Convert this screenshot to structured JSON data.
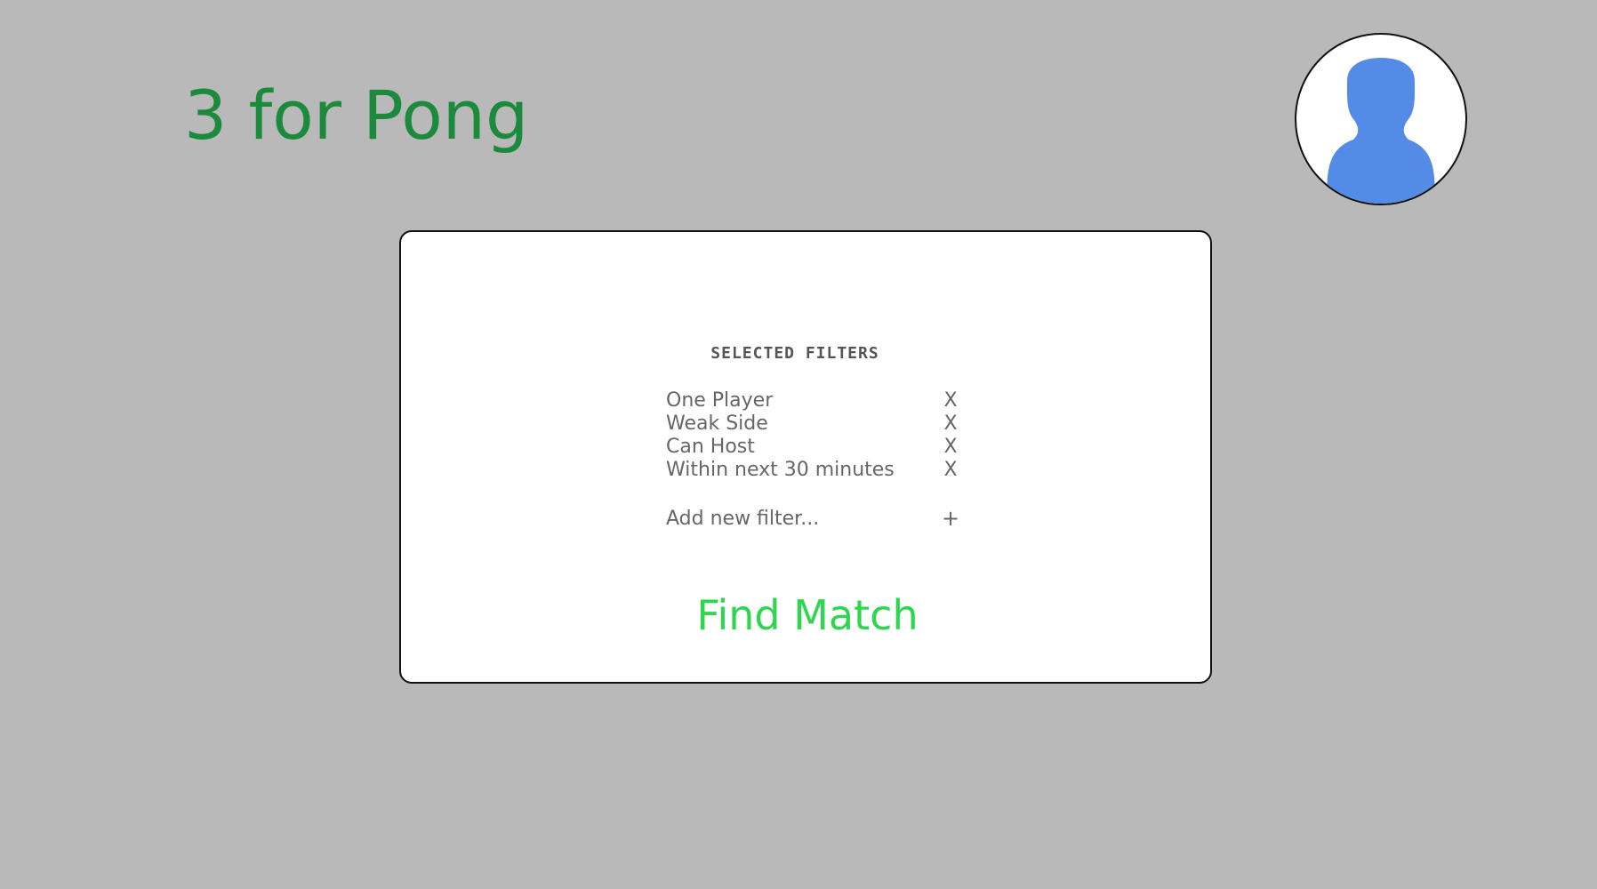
{
  "app": {
    "title": "3 for Pong"
  },
  "avatar": {
    "icon": "user-silhouette-icon",
    "color": "#548be6"
  },
  "filters": {
    "heading": "SELECTED FILTERS",
    "items": [
      {
        "label": "One Player",
        "remove": "X"
      },
      {
        "label": "Weak Side",
        "remove": "X"
      },
      {
        "label": "Can Host",
        "remove": "X"
      },
      {
        "label": "Within next 30 minutes",
        "remove": "X"
      }
    ],
    "add_label": "Add new filter...",
    "add_icon": "+"
  },
  "actions": {
    "find_match_label": "Find Match"
  },
  "colors": {
    "background": "#b9b9b9",
    "title": "#1c8a3c",
    "find_match": "#2ed64e",
    "avatar_fill": "#548be6"
  }
}
